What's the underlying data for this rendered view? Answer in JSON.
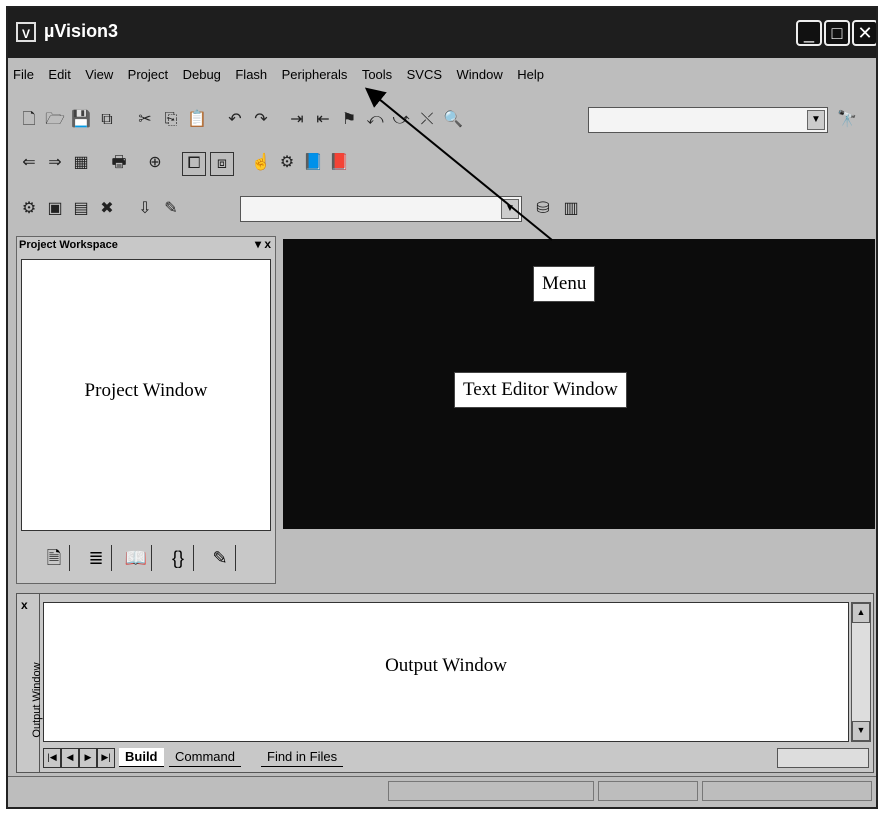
{
  "window": {
    "title": "µVision3",
    "app_icon": "uvision-app-icon",
    "controls": [
      "minimize-icon",
      "maximize-icon",
      "close-icon"
    ]
  },
  "menu": {
    "items": [
      "File",
      "Edit",
      "View",
      "Project",
      "Debug",
      "Flash",
      "Peripherals",
      "Tools",
      "SVCS",
      "Window",
      "Help"
    ]
  },
  "project_workspace": {
    "title": "Project Workspace",
    "controls": "▾ x",
    "annotation": "Project Window",
    "tabs": [
      "files-tab-icon",
      "regs-tab-icon",
      "books-tab-icon",
      "functions-tab-icon",
      "templates-tab-icon"
    ]
  },
  "editor": {
    "annotation": "Text Editor Window"
  },
  "callout": {
    "label": "Menu"
  },
  "output": {
    "side_label": "Output Window",
    "side_close": "x",
    "annotation": "Output Window",
    "tabs": [
      "Build",
      "Command",
      "Find in Files"
    ],
    "active_tab": "Build"
  },
  "colors": {
    "editor_bg": "#0c0c0c",
    "titlebar_bg": "#1e1e1e",
    "chrome_bg": "#bdbdbd"
  }
}
